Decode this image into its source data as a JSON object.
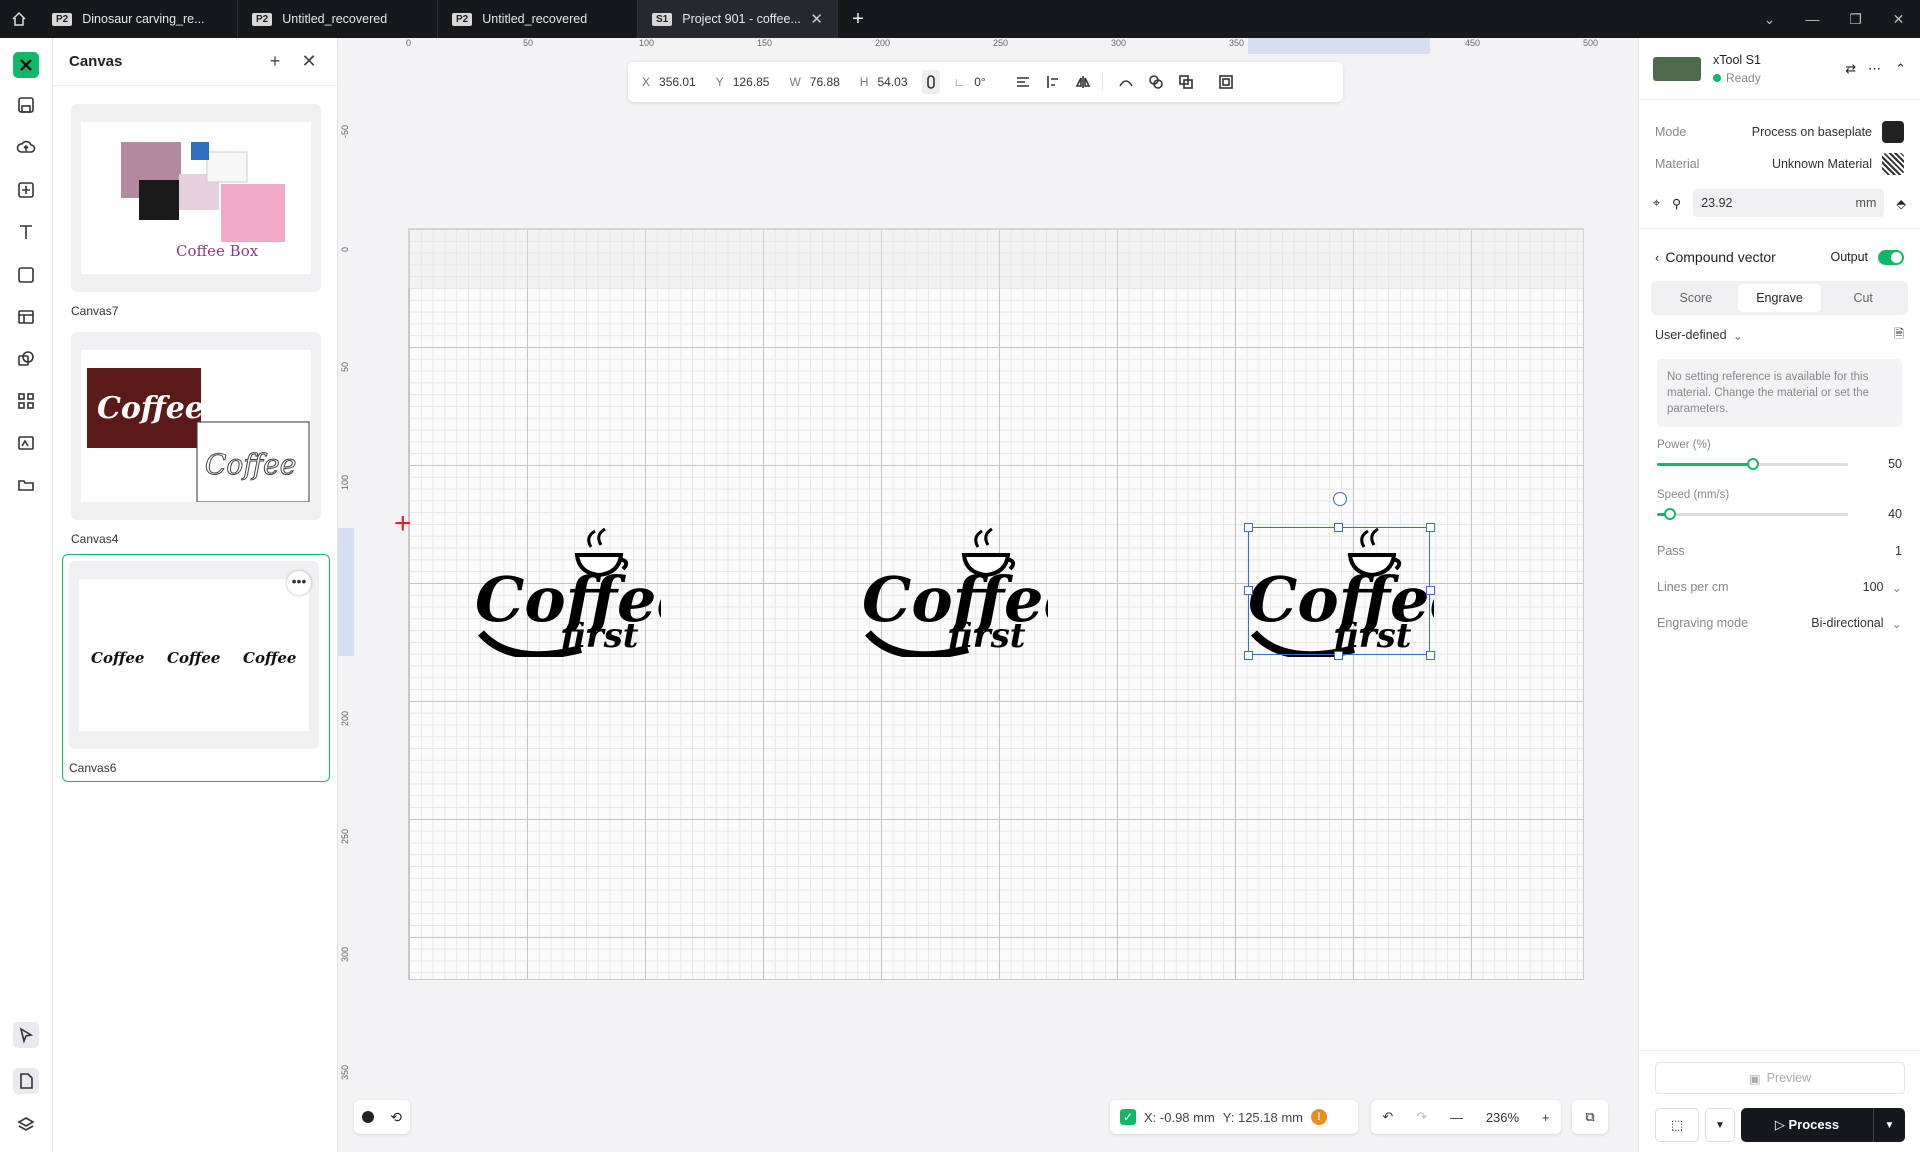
{
  "tabs": [
    {
      "badge": "P2",
      "title": "Dinosaur carving_re..."
    },
    {
      "badge": "P2",
      "title": "Untitled_recovered"
    },
    {
      "badge": "P2",
      "title": "Untitled_recovered"
    },
    {
      "badge": "S1",
      "title": "Project 901 - coffee...",
      "active": true
    }
  ],
  "panel": {
    "title": "Canvas",
    "cards": [
      {
        "label": "Canvas7",
        "caption": "Coffee Box"
      },
      {
        "label": "Canvas4"
      },
      {
        "label": "Canvas6",
        "active": true
      }
    ]
  },
  "toolbar": {
    "x_label": "X",
    "x": "356.01",
    "y_label": "Y",
    "y": "126.85",
    "w_label": "W",
    "w": "76.88",
    "h_label": "H",
    "h": "54.03",
    "angle": "0°"
  },
  "ruler_top": [
    "0",
    "50",
    "100",
    "150",
    "200",
    "250",
    "300",
    "350",
    "400",
    "450",
    "500"
  ],
  "ruler_left": [
    "-50",
    "0",
    "50",
    "100",
    "150",
    "200",
    "250",
    "300",
    "350"
  ],
  "logo": {
    "line1": "Coffee",
    "line2": "first"
  },
  "status": {
    "x": "X: -0.98 mm",
    "y": "Y: 125.18 mm",
    "warn": "!"
  },
  "zoom": "236%",
  "device": {
    "name": "xTool S1",
    "status": "Ready"
  },
  "settings": {
    "mode_label": "Mode",
    "mode_value": "Process on baseplate",
    "material_label": "Material",
    "material_value": "Unknown Material",
    "thickness": "23.92",
    "thickness_unit": "mm"
  },
  "layer": {
    "title": "Compound vector",
    "output_label": "Output",
    "tabs": [
      "Score",
      "Engrave",
      "Cut"
    ],
    "active_tab": "Engrave",
    "preset": "User-defined",
    "note": "No setting reference is available for this material. Change the material or set the parameters.",
    "power_label": "Power (%)",
    "power": 50,
    "speed_label": "Speed (mm/s)",
    "speed": 40,
    "pass_label": "Pass",
    "pass": "1",
    "lpc_label": "Lines per cm",
    "lpc": "100",
    "mode_label": "Engraving mode",
    "mode": "Bi-directional"
  },
  "buttons": {
    "preview": "Preview",
    "process": "Process"
  },
  "colors": {
    "accent": "#12b76a",
    "selection": "#3a6bd0",
    "warning": "#f08c1e"
  }
}
